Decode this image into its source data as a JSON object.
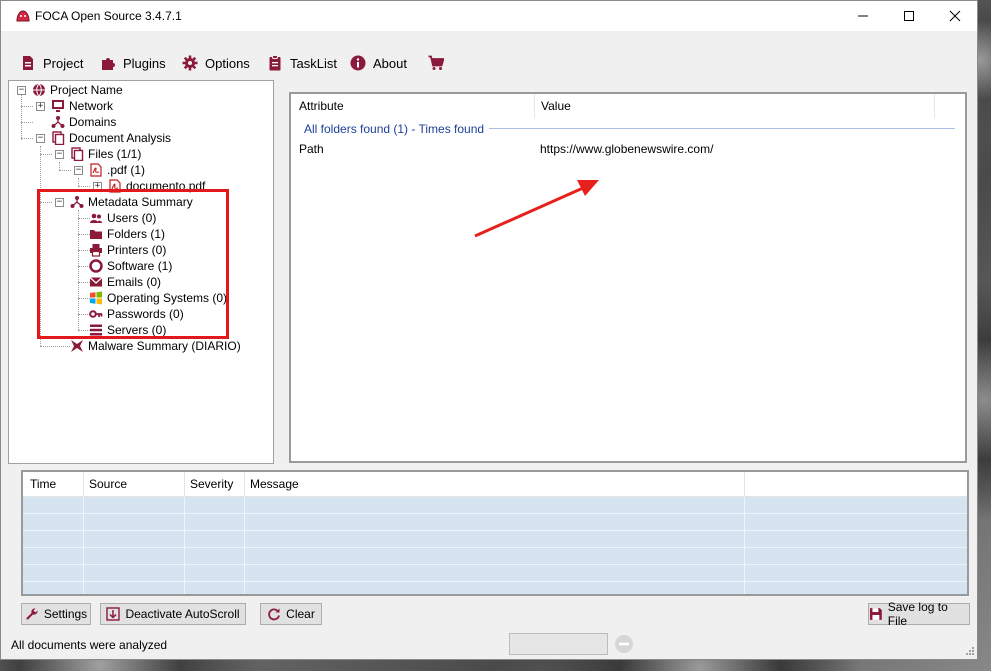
{
  "window": {
    "title": "FOCA Open Source 3.4.7.1",
    "controls": [
      "minimize",
      "maximize",
      "close"
    ]
  },
  "menu": [
    {
      "label": "Project",
      "icon": "document-icon"
    },
    {
      "label": "Plugins",
      "icon": "puzzle-icon"
    },
    {
      "label": "Options",
      "icon": "gear-icon"
    },
    {
      "label": "TaskList",
      "icon": "clipboard-icon"
    },
    {
      "label": "About",
      "icon": "info-icon"
    },
    {
      "label": "",
      "icon": "cart-icon"
    }
  ],
  "tree": {
    "root": "Project Name",
    "network": "Network",
    "domains": "Domains",
    "document_analysis": "Document Analysis",
    "files": "Files (1/1)",
    "pdf": ".pdf (1)",
    "document": "documento.pdf",
    "metadata_summary": "Metadata Summary",
    "metadata_items": [
      {
        "label": "Users (0)",
        "icon": "users-icon"
      },
      {
        "label": "Folders (1)",
        "icon": "folder-icon"
      },
      {
        "label": "Printers (0)",
        "icon": "printer-icon"
      },
      {
        "label": "Software (1)",
        "icon": "software-icon"
      },
      {
        "label": "Emails (0)",
        "icon": "email-icon"
      },
      {
        "label": "Operating Systems (0)",
        "icon": "windows-icon"
      },
      {
        "label": "Passwords (0)",
        "icon": "key-icon"
      },
      {
        "label": "Servers (0)",
        "icon": "server-icon"
      }
    ],
    "malware_summary": "Malware Summary (DIARIO)"
  },
  "details": {
    "columns": [
      "Attribute",
      "Value"
    ],
    "group_title": "All folders found (1) - Times found",
    "rows": [
      {
        "attribute": "Path",
        "value": "https://www.globenewswire.com/"
      }
    ]
  },
  "log": {
    "columns": [
      "Time",
      "Source",
      "Severity",
      "Message"
    ],
    "row_count": 6
  },
  "buttons": {
    "settings": "Settings",
    "deactivate_autoscroll": "Deactivate AutoScroll",
    "clear": "Clear",
    "save_log": "Save log to File"
  },
  "status": {
    "text": "All documents were analyzed"
  },
  "colors": {
    "accent": "#8b1a3a",
    "highlight_box": "#e3181c",
    "arrow": "#e8201b",
    "group_title": "#1e3f99",
    "log_row": "#d6e4f2"
  }
}
